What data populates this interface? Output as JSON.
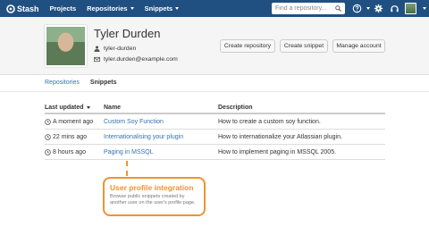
{
  "nav": {
    "logo": "Stash",
    "items": [
      {
        "label": "Projects",
        "dropdown": false
      },
      {
        "label": "Repositories",
        "dropdown": true
      },
      {
        "label": "Snippets",
        "dropdown": true
      }
    ],
    "search_placeholder": "Find a repository...",
    "colors": {
      "bar": "#205081"
    }
  },
  "profile": {
    "name": "Tyler Durden",
    "username": "tyler-durden",
    "email": "tyler.durden@example.com",
    "buttons": [
      "Create repository",
      "Create snippet",
      "Manage account"
    ]
  },
  "tabs": [
    {
      "label": "Repositories",
      "active": false
    },
    {
      "label": "Snippets",
      "active": true
    }
  ],
  "table": {
    "headers": [
      "Last updated",
      "Name",
      "Description"
    ],
    "rows": [
      {
        "updated": "A moment ago",
        "name": "Custom Soy Function",
        "description": "How to create a custom soy function."
      },
      {
        "updated": "22 mins ago",
        "name": "Internationalising your plugin",
        "description": "How to internationalize your Atlassian plugin."
      },
      {
        "updated": "8 hours ago",
        "name": "Paging in MSSQL",
        "description": "How to implement paging in MSSQL 2005."
      }
    ]
  },
  "annotation": {
    "title": "User profile integration",
    "text": "Browse public snippets created by another user on the user's profile page.",
    "color": "#f0932f"
  }
}
